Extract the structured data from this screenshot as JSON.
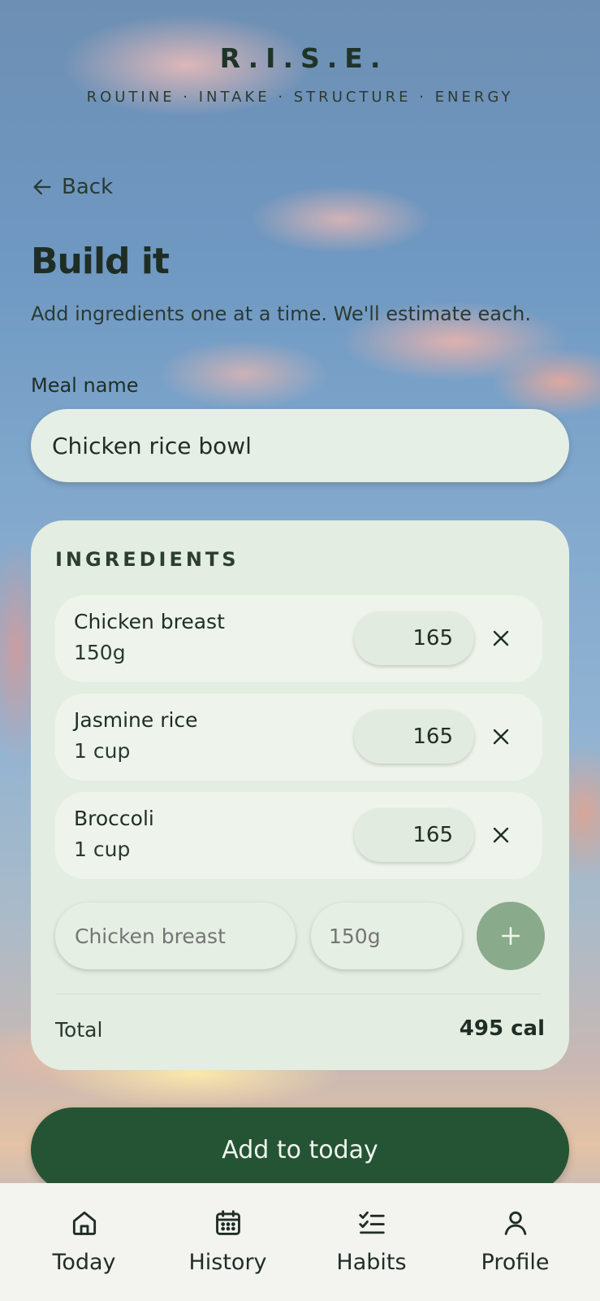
{
  "brand": {
    "title": "R.I.S.E.",
    "subtitle": "ROUTINE · INTAKE · STRUCTURE · ENERGY"
  },
  "nav_back": {
    "label": "Back",
    "icon": "arrow-left-icon"
  },
  "page": {
    "title": "Build it",
    "subtitle": "Add ingredients one at a time. We'll estimate each."
  },
  "meal": {
    "label": "Meal name",
    "value": "Chicken rice bowl"
  },
  "ingredients": {
    "heading": "INGREDIENTS",
    "items": [
      {
        "name": "Chicken breast",
        "qty": "150g",
        "calories": "165"
      },
      {
        "name": "Jasmine rice",
        "qty": "1 cup",
        "calories": "165"
      },
      {
        "name": "Broccoli",
        "qty": "1 cup",
        "calories": "165"
      }
    ],
    "new_name_placeholder": "Chicken breast",
    "new_qty_placeholder": "150g",
    "total_label": "Total",
    "total_value": "495 cal"
  },
  "actions": {
    "add_to_today": "Add to today"
  },
  "bottom_nav": [
    {
      "label": "Today",
      "icon": "home-icon"
    },
    {
      "label": "History",
      "icon": "calendar-icon"
    },
    {
      "label": "Habits",
      "icon": "checklist-icon"
    },
    {
      "label": "Profile",
      "icon": "person-icon"
    }
  ],
  "colors": {
    "primary": "#245433",
    "add_button": "#8aaa8c",
    "card": "#e3ede2"
  }
}
